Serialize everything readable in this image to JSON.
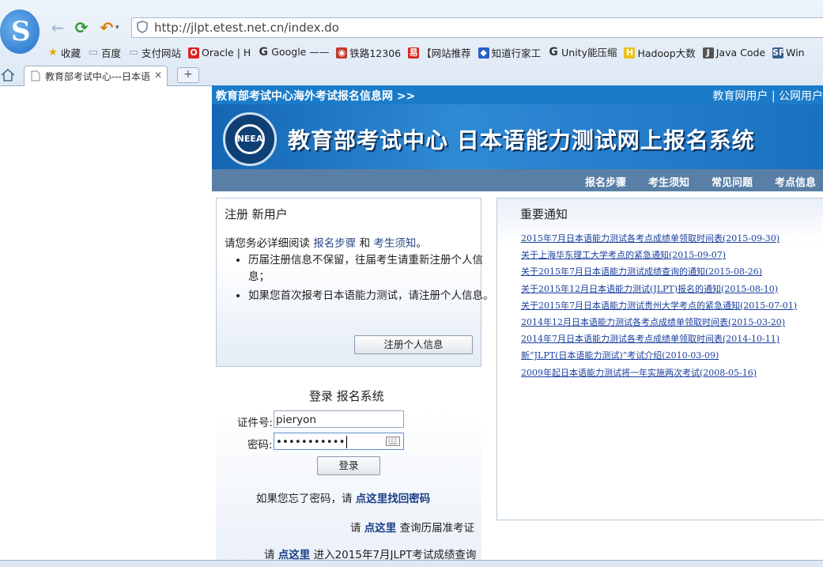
{
  "browser": {
    "url": "http://jlpt.etest.net.cn/index.do",
    "tab_title": "教育部考试中心---日本语",
    "bookmarks": [
      {
        "label": "收藏",
        "icon": "star-icon",
        "color": "#e6a500"
      },
      {
        "label": "百度",
        "icon": "folder-icon",
        "color": "#8aa0bd"
      },
      {
        "label": "支付网站",
        "icon": "folder-icon",
        "color": "#8aa0bd"
      },
      {
        "label": "Oracle | H",
        "icon": "oracle-icon",
        "color": "#d92323"
      },
      {
        "label": "Google ——",
        "icon": "google-icon",
        "color": "#333333"
      },
      {
        "label": "铁路12306",
        "icon": "rail-icon",
        "color": "#c0392b"
      },
      {
        "label": "【网站推荐",
        "icon": "site-icon",
        "color": "#d9261c"
      },
      {
        "label": "知道行家工",
        "icon": "baidu-icon",
        "color": "#2b5fc9"
      },
      {
        "label": "Unity能压缩",
        "icon": "google-icon",
        "color": "#333333"
      },
      {
        "label": "Hadoop大数",
        "icon": "hadoop-icon",
        "color": "#e8c21a"
      },
      {
        "label": "Java Code",
        "icon": "java-icon",
        "color": "#555555"
      },
      {
        "label": "Win",
        "icon": "sf-icon",
        "color": "#3a5f8a"
      }
    ]
  },
  "site": {
    "top_left": "教育部考试中心海外考试报名信息网 >>",
    "top_right": "教育网用户 | 公网用户",
    "emblem_text": "NEEA",
    "banner_title": "教育部考试中心  日本语能力测试网上报名系统",
    "menu": [
      "报名步骤",
      "考生须知",
      "常见问题",
      "考点信息"
    ]
  },
  "register": {
    "heading": "注册  新用户",
    "intro_prefix": "请您务必详细阅读 ",
    "link1": "报名步骤",
    "intro_mid": " 和 ",
    "link2": "考生须知",
    "intro_suffix": "。",
    "bullets": [
      "历届注册信息不保留，往届考生请重新注册个人信息；",
      "如果您首次报考日本语能力测试，请注册个人信息。"
    ],
    "button": "注册个人信息"
  },
  "login": {
    "heading": "登录  报名系统",
    "id_label": "证件号:",
    "id_value": "pieryon",
    "pwd_label": "密码:",
    "pwd_value": "•••••••••••",
    "button": "登录",
    "forgot_prefix": "如果您忘了密码，请 ",
    "forgot_link": "点这里找回密码",
    "history_prefix": "请 ",
    "history_link": "点这里",
    "history_suffix": " 查询历届准考证",
    "score_prefix": "请 ",
    "score_link": "点这里",
    "score_suffix": " 进入2015年7月JLPT考试成绩查询"
  },
  "notices": {
    "heading": "重要通知",
    "items": [
      "2015年7月日本语能力测试各考点成绩单领取时间表(2015-09-30)",
      "关于上海华东理工大学考点的紧急通知(2015-09-07)",
      "关于2015年7月日本语能力测试成绩查询的通知(2015-08-26)",
      "关于2015年12月日本语能力测试(JLPT)报名的通知(2015-08-10)",
      "关于2015年7月日本语能力测试贵州大学考点的紧急通知(2015-07-01)",
      "2014年12月日本语能力测试各考点成绩单领取时间表(2015-03-20)",
      "2014年7月日本语能力测试各考点成绩单领取时间表(2014-10-11)",
      "新“JLPT(日本语能力测试)”考试介绍(2010-03-09)",
      "2009年起日本语能力测试将一年实施两次考试(2008-05-16)"
    ]
  }
}
